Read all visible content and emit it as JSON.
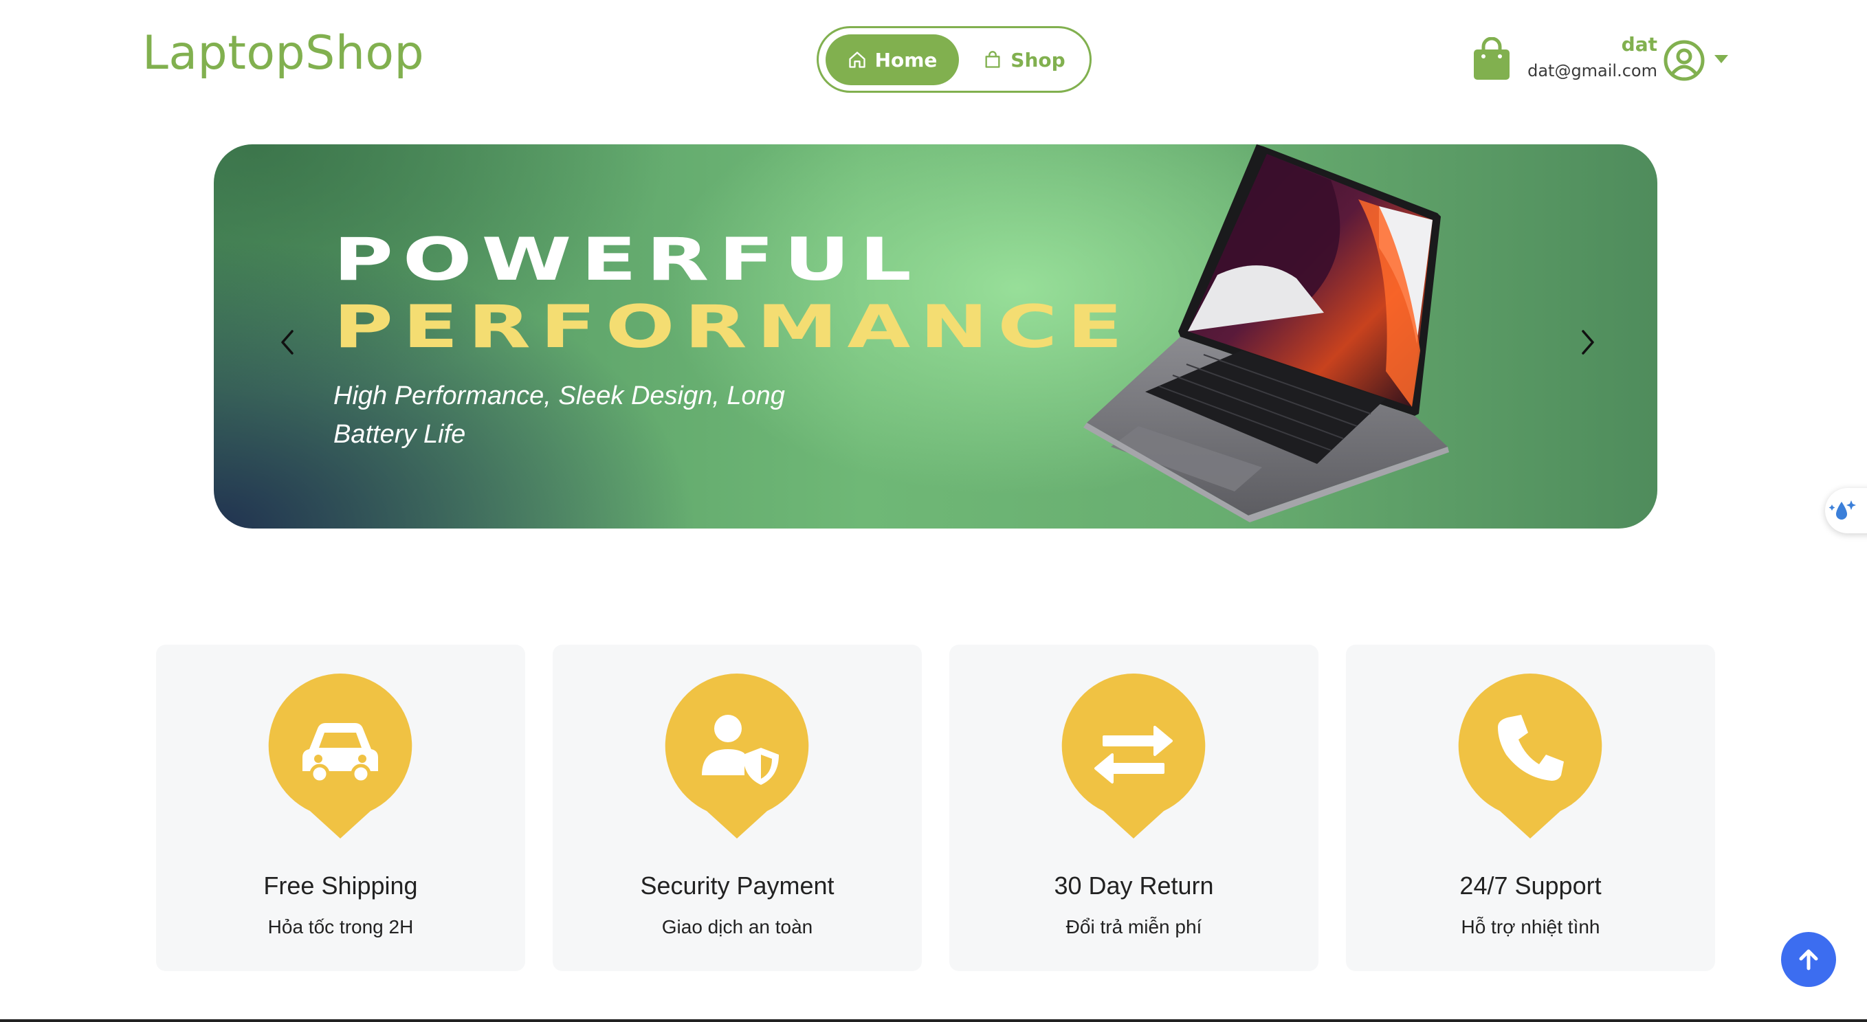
{
  "header": {
    "brand": "LaptopShop",
    "nav": [
      {
        "label": "Home",
        "icon": "home-icon",
        "active": true
      },
      {
        "label": "Shop",
        "icon": "shopping-bag-icon",
        "active": false
      }
    ],
    "user": {
      "name": "dat",
      "email": "dat@gmail.com",
      "cart_icon": "shopping-bag-icon",
      "avatar_icon": "user-circle-icon",
      "menu_icon": "caret-down-icon"
    }
  },
  "banner": {
    "title_line1": "POWERFUL",
    "title_line2": "PERFORMANCE",
    "subtitle": "High Performance, Sleek Design, Long Battery Life",
    "prev_icon": "chevron-left-icon",
    "next_icon": "chevron-right-icon"
  },
  "features": [
    {
      "icon": "car-icon",
      "title": "Free Shipping",
      "subtitle": "Hỏa tốc trong 2H"
    },
    {
      "icon": "user-shield-icon",
      "title": "Security Payment",
      "subtitle": "Giao dịch an toàn"
    },
    {
      "icon": "exchange-arrows-icon",
      "title": "30 Day Return",
      "subtitle": "Đổi trả miễn phí"
    },
    {
      "icon": "phone-icon",
      "title": "24/7 Support",
      "subtitle": "Hỗ trợ nhiệt tình"
    }
  ],
  "colors": {
    "brand": "#81b04f",
    "accent_yellow": "#f0c243",
    "banner_title_yellow": "#f4dd72",
    "back_to_top": "#3c6df0"
  },
  "back_to_top_icon": "arrow-up-icon",
  "side_widget_icon": "water-drop-sparkle-icon"
}
